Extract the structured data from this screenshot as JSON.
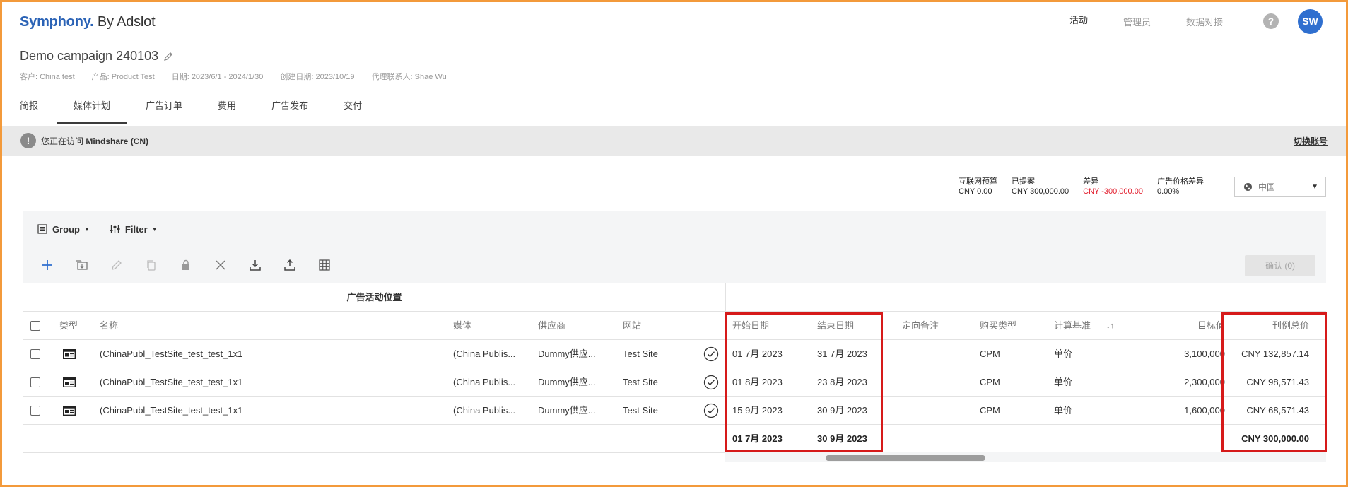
{
  "header": {
    "logo_brand": "Symphony.",
    "logo_rest": " By Adslot",
    "nav": [
      "活动",
      "管理员",
      "数据对接"
    ],
    "help": "?",
    "avatar": "SW"
  },
  "campaign": {
    "title": "Demo campaign 240103",
    "meta": [
      "客户: China test",
      "产品: Product Test",
      "日期: 2023/6/1 - 2024/1/30",
      "创建日期: 2023/10/19",
      "代理联系人: Shae Wu"
    ]
  },
  "tabs": [
    "简报",
    "媒体计划",
    "广告订单",
    "费用",
    "广告发布",
    "交付"
  ],
  "notice": {
    "prefix": "您正在访问 ",
    "org": "Mindshare (CN)",
    "switch": "切换账号"
  },
  "summary": [
    {
      "label": "互联网预算",
      "value": "CNY 0.00"
    },
    {
      "label": "已提案",
      "value": "CNY 300,000.00"
    },
    {
      "label": "差异",
      "value": "CNY -300,000.00"
    },
    {
      "label": "广告价格差异",
      "value": "0.00%"
    }
  ],
  "region": "中国",
  "controls": {
    "group": "Group",
    "filter": "Filter"
  },
  "toolbar": {
    "confirm": "确认 (0)"
  },
  "table": {
    "group_title": "广告活动位置",
    "headers": {
      "type": "类型",
      "name": "名称",
      "media": "媒体",
      "vendor": "供应商",
      "site": "网站",
      "start": "开始日期",
      "end": "结束日期",
      "targeting": "定向备注",
      "buy_type": "购买类型",
      "basis": "计算基准",
      "sort": "↓↑",
      "target": "目标值",
      "total": "刊例总价"
    },
    "rows": [
      {
        "name": "(ChinaPubl_TestSite_test_test_1x1",
        "media": "(China Publis...",
        "vendor": "Dummy供应...",
        "site": "Test Site",
        "start": "01 7月 2023",
        "end": "31 7月 2023",
        "buy_type": "CPM",
        "basis": "单价",
        "target": "3,100,000",
        "total": "CNY 132,857.14"
      },
      {
        "name": "(ChinaPubl_TestSite_test_test_1x1",
        "media": "(China Publis...",
        "vendor": "Dummy供应...",
        "site": "Test Site",
        "start": "01 8月 2023",
        "end": "23 8月 2023",
        "buy_type": "CPM",
        "basis": "单价",
        "target": "2,300,000",
        "total": "CNY 98,571.43"
      },
      {
        "name": "(ChinaPubl_TestSite_test_test_1x1",
        "media": "(China Publis...",
        "vendor": "Dummy供应...",
        "site": "Test Site",
        "start": "15 9月 2023",
        "end": "30 9月 2023",
        "buy_type": "CPM",
        "basis": "单价",
        "target": "1,600,000",
        "total": "CNY 68,571.43"
      }
    ],
    "totals": {
      "start": "01 7月 2023",
      "end": "30 9月 2023",
      "total": "CNY 300,000.00"
    }
  }
}
